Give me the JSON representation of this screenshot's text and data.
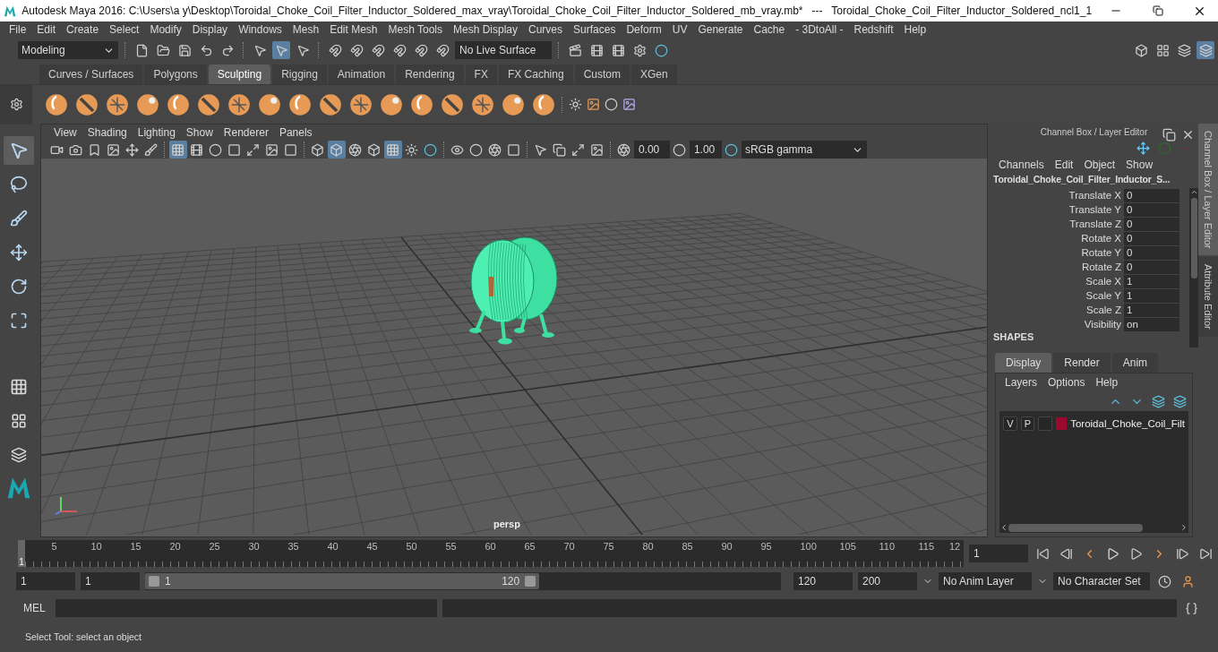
{
  "window": {
    "title": "Autodesk Maya 2016: C:\\Users\\a y\\Desktop\\Toroidal_Choke_Coil_Filter_Inductor_Soldered_max_vray\\Toroidal_Choke_Coil_Filter_Inductor_Soldered_mb_vray.mb*   ---   Toroidal_Choke_Coil_Filter_Inductor_Soldered_ncl1_1"
  },
  "menu_bar": [
    "File",
    "Edit",
    "Create",
    "Select",
    "Modify",
    "Display",
    "Windows",
    "Mesh",
    "Edit Mesh",
    "Mesh Tools",
    "Mesh Display",
    "Curves",
    "Surfaces",
    "Deform",
    "UV",
    "Generate",
    "Cache",
    "- 3DtoAll -",
    "Redshift",
    "Help"
  ],
  "status_line": {
    "mode": "Modeling",
    "live_surface": "No Live Surface"
  },
  "shelf_tabs": [
    {
      "label": "Curves / Surfaces",
      "selected": false
    },
    {
      "label": "Polygons",
      "selected": false
    },
    {
      "label": "Sculpting",
      "selected": true
    },
    {
      "label": "Rigging",
      "selected": false
    },
    {
      "label": "Animation",
      "selected": false
    },
    {
      "label": "Rendering",
      "selected": false
    },
    {
      "label": "FX",
      "selected": false
    },
    {
      "label": "FX Caching",
      "selected": false
    },
    {
      "label": "Custom",
      "selected": false
    },
    {
      "label": "XGen",
      "selected": false
    }
  ],
  "viewport": {
    "menu": [
      "View",
      "Shading",
      "Lighting",
      "Show",
      "Renderer",
      "Panels"
    ],
    "exposure": "0.00",
    "gamma": "1.00",
    "color_space": "sRGB gamma",
    "camera": "persp"
  },
  "channel_box": {
    "title": "Channel Box / Layer Editor",
    "menu": [
      "Channels",
      "Edit",
      "Object",
      "Show"
    ],
    "object_name": "Toroidal_Choke_Coil_Filter_Inductor_S...",
    "channels": [
      {
        "name": "Translate X",
        "value": "0"
      },
      {
        "name": "Translate Y",
        "value": "0"
      },
      {
        "name": "Translate Z",
        "value": "0"
      },
      {
        "name": "Rotate X",
        "value": "0"
      },
      {
        "name": "Rotate Y",
        "value": "0"
      },
      {
        "name": "Rotate Z",
        "value": "0"
      },
      {
        "name": "Scale X",
        "value": "1"
      },
      {
        "name": "Scale Y",
        "value": "1"
      },
      {
        "name": "Scale Z",
        "value": "1"
      },
      {
        "name": "Visibility",
        "value": "on"
      }
    ],
    "shapes_header": "SHAPES",
    "side_tabs": [
      {
        "label": "Channel Box / Layer Editor",
        "selected": true
      },
      {
        "label": "Attribute Editor",
        "selected": false
      }
    ]
  },
  "layer_editor": {
    "tabs": [
      {
        "label": "Display",
        "selected": true
      },
      {
        "label": "Render",
        "selected": false
      },
      {
        "label": "Anim",
        "selected": false
      }
    ],
    "menu": [
      "Layers",
      "Options",
      "Help"
    ],
    "layers": [
      {
        "visible": "V",
        "playback": "P",
        "color": "#9b0a2e",
        "name": "Toroidal_Choke_Coil_Filt"
      }
    ]
  },
  "timeline": {
    "labels": [
      "5",
      "10",
      "15",
      "20",
      "25",
      "30",
      "35",
      "40",
      "45",
      "50",
      "55",
      "60",
      "65",
      "70",
      "75",
      "80",
      "85",
      "90",
      "95",
      "100",
      "105",
      "110",
      "115",
      "12"
    ],
    "current": "1",
    "level": 0,
    "current_frame": "1"
  },
  "range": {
    "start": "1",
    "playback_start": "1",
    "slider_start": "1",
    "slider_end": "120",
    "level": 0.62,
    "playback_end": "120",
    "end": "200",
    "anim_layer": "No Anim Layer",
    "character_set": "No Character Set"
  },
  "command_line": {
    "label": "MEL"
  },
  "help_line": "Select Tool: select an object"
}
